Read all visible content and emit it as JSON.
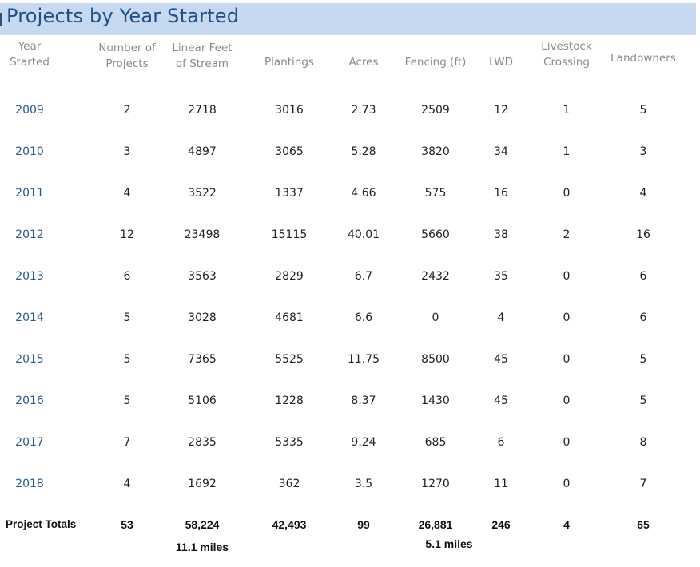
{
  "title": "Projects by Year Started",
  "chart_data": {
    "type": "table",
    "title": "Projects by Year Started",
    "columns": [
      "Year Started",
      "Number of Projects",
      "Linear Feet of Stream",
      "Plantings",
      "Acres",
      "Fencing (ft)",
      "LWD",
      "Livestock Crossing",
      "Landowners"
    ],
    "header_lines": [
      [
        "Year",
        "Started"
      ],
      [
        "Number of",
        "Projects"
      ],
      [
        "Linear Feet",
        "of Stream"
      ],
      [
        "Plantings"
      ],
      [
        "Acres"
      ],
      [
        "Fencing (ft)"
      ],
      [
        "LWD"
      ],
      [
        "Livestock",
        "Crossing"
      ],
      [
        "Landowners"
      ]
    ],
    "rows": [
      [
        "2009",
        "2",
        "2718",
        "3016",
        "2.73",
        "2509",
        "12",
        "1",
        "5"
      ],
      [
        "2010",
        "3",
        "4897",
        "3065",
        "5.28",
        "3820",
        "34",
        "1",
        "3"
      ],
      [
        "2011",
        "4",
        "3522",
        "1337",
        "4.66",
        "575",
        "16",
        "0",
        "4"
      ],
      [
        "2012",
        "12",
        "23498",
        "15115",
        "40.01",
        "5660",
        "38",
        "2",
        "16"
      ],
      [
        "2013",
        "6",
        "3563",
        "2829",
        "6.7",
        "2432",
        "35",
        "0",
        "6"
      ],
      [
        "2014",
        "5",
        "3028",
        "4681",
        "6.6",
        "0",
        "4",
        "0",
        "6"
      ],
      [
        "2015",
        "5",
        "7365",
        "5525",
        "11.75",
        "8500",
        "45",
        "0",
        "5"
      ],
      [
        "2016",
        "5",
        "5106",
        "1228",
        "8.37",
        "1430",
        "45",
        "0",
        "5"
      ],
      [
        "2017",
        "7",
        "2835",
        "5335",
        "9.24",
        "685",
        "6",
        "0",
        "8"
      ],
      [
        "2018",
        "4",
        "1692",
        "362",
        "3.5",
        "1270",
        "11",
        "0",
        "7"
      ]
    ],
    "totals": {
      "label": "Project Totals",
      "values": [
        "53",
        "58,224",
        "42,493",
        "99",
        "26,881",
        "246",
        "4",
        "65"
      ]
    },
    "notes": {
      "linear_feet_miles": "11.1 miles",
      "fencing_miles": "5.1  miles"
    }
  },
  "colors": {
    "title_bar": "#c6d9f1",
    "title_text": "#1f4f86",
    "year_text": "#2a5a8c",
    "header_text": "#8a8a8a"
  }
}
